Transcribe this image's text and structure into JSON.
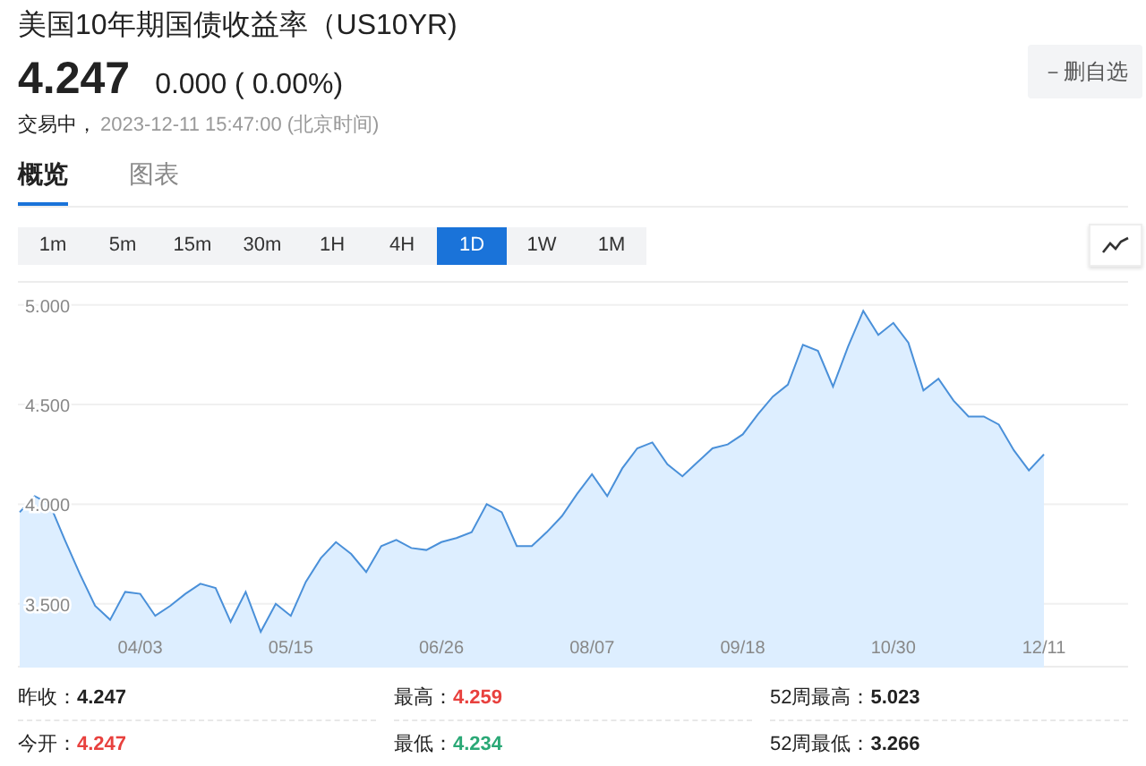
{
  "header": {
    "title": "美国10年期国债收益率（US10YR)",
    "price": "4.247",
    "change": "0.000 ( 0.00%)",
    "status": "交易中，",
    "time": "2023-12-11 15:47:00 (北京时间)",
    "watch_button": "－删自选"
  },
  "tabs": [
    {
      "label": "概览",
      "selected": true
    },
    {
      "label": "图表",
      "selected": false
    }
  ],
  "periods": [
    {
      "label": "1m",
      "selected": false
    },
    {
      "label": "5m",
      "selected": false
    },
    {
      "label": "15m",
      "selected": false
    },
    {
      "label": "30m",
      "selected": false
    },
    {
      "label": "1H",
      "selected": false
    },
    {
      "label": "4H",
      "selected": false
    },
    {
      "label": "1D",
      "selected": true
    },
    {
      "label": "1W",
      "selected": false
    },
    {
      "label": "1M",
      "selected": false
    }
  ],
  "chart": {
    "chart_data": {
      "type": "area",
      "grid": true,
      "ylim": [
        3.18,
        5.12
      ],
      "yticks": [
        {
          "value": 3.5,
          "label": "3.500"
        },
        {
          "value": 4,
          "label": "4.000"
        },
        {
          "value": 4.5,
          "label": "4.500"
        },
        {
          "value": 5,
          "label": "5.000"
        }
      ],
      "categories": [
        null,
        null,
        null,
        null,
        null,
        null,
        null,
        null,
        "04/03",
        null,
        null,
        null,
        null,
        null,
        null,
        null,
        null,
        null,
        "05/15",
        null,
        null,
        null,
        null,
        null,
        null,
        null,
        null,
        null,
        "06/26",
        null,
        null,
        null,
        null,
        null,
        null,
        null,
        null,
        null,
        "08/07",
        null,
        null,
        null,
        null,
        null,
        null,
        null,
        null,
        null,
        "09/18",
        null,
        null,
        null,
        null,
        null,
        null,
        null,
        null,
        null,
        "10/30",
        null,
        null,
        null,
        null,
        null,
        null,
        null,
        null,
        null,
        "12/11"
      ],
      "series": [
        {
          "color": "#4a90d9",
          "values": [
            3.96,
            4.04,
            4.0,
            3.82,
            3.65,
            3.49,
            3.42,
            3.56,
            3.55,
            3.44,
            3.49,
            3.55,
            3.6,
            3.58,
            3.41,
            3.56,
            3.36,
            3.5,
            3.44,
            3.61,
            3.73,
            3.81,
            3.75,
            3.66,
            3.79,
            3.82,
            3.78,
            3.77,
            3.81,
            3.83,
            3.86,
            4.0,
            3.96,
            3.79,
            3.79,
            3.86,
            3.94,
            4.05,
            4.15,
            4.04,
            4.18,
            4.28,
            4.31,
            4.2,
            4.14,
            4.21,
            4.28,
            4.3,
            4.35,
            4.45,
            4.54,
            4.6,
            4.8,
            4.77,
            4.59,
            4.79,
            4.97,
            4.85,
            4.91,
            4.81,
            4.57,
            4.63,
            4.52,
            4.44,
            4.44,
            4.4,
            4.27,
            4.17,
            4.25
          ]
        }
      ]
    }
  },
  "stats": [
    {
      "label": "昨收：",
      "value": "4.247",
      "color": "#222222"
    },
    {
      "label": "最高：",
      "value": "4.259",
      "color": "#e8413e"
    },
    {
      "label": "52周最高：",
      "value": "5.023",
      "color": "#222222"
    },
    {
      "label": "今开：",
      "value": "4.247",
      "color": "#e8413e"
    },
    {
      "label": "最低：",
      "value": "4.234",
      "color": "#2aa876"
    },
    {
      "label": "52周最低：",
      "value": "3.266",
      "color": "#222222"
    }
  ]
}
